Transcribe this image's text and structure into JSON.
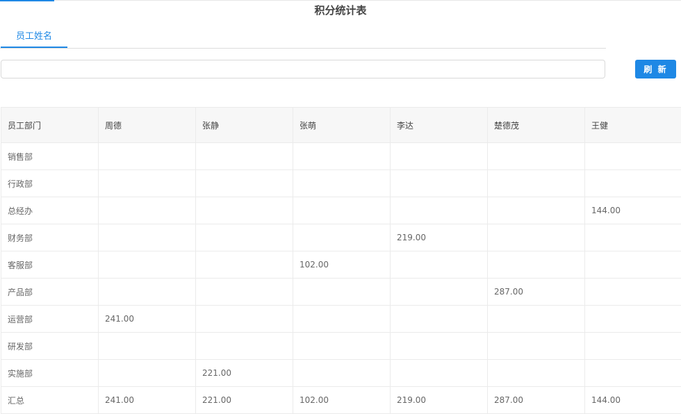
{
  "page": {
    "title": "积分统计表"
  },
  "tabs": [
    {
      "label": "员工姓名"
    }
  ],
  "search": {
    "value": "",
    "placeholder": ""
  },
  "toolbar": {
    "refresh_label": "刷 新"
  },
  "colors": {
    "accent": "#1e88e5",
    "header_bg": "#f7f7f7",
    "border": "#ebebeb"
  },
  "table": {
    "columns": [
      "员工部门",
      "周德",
      "张静",
      "张萌",
      "李达",
      "楚德茂",
      "王健"
    ],
    "rows": [
      [
        "销售部",
        "",
        "",
        "",
        "",
        "",
        ""
      ],
      [
        "行政部",
        "",
        "",
        "",
        "",
        "",
        ""
      ],
      [
        "总经办",
        "",
        "",
        "",
        "",
        "",
        "144.00"
      ],
      [
        "财务部",
        "",
        "",
        "",
        "219.00",
        "",
        ""
      ],
      [
        "客服部",
        "",
        "",
        "102.00",
        "",
        "",
        ""
      ],
      [
        "产品部",
        "",
        "",
        "",
        "",
        "287.00",
        ""
      ],
      [
        "运营部",
        "241.00",
        "",
        "",
        "",
        "",
        ""
      ],
      [
        "研发部",
        "",
        "",
        "",
        "",
        "",
        ""
      ],
      [
        "实施部",
        "",
        "221.00",
        "",
        "",
        "",
        ""
      ],
      [
        "汇总",
        "241.00",
        "221.00",
        "102.00",
        "219.00",
        "287.00",
        "144.00"
      ]
    ]
  }
}
